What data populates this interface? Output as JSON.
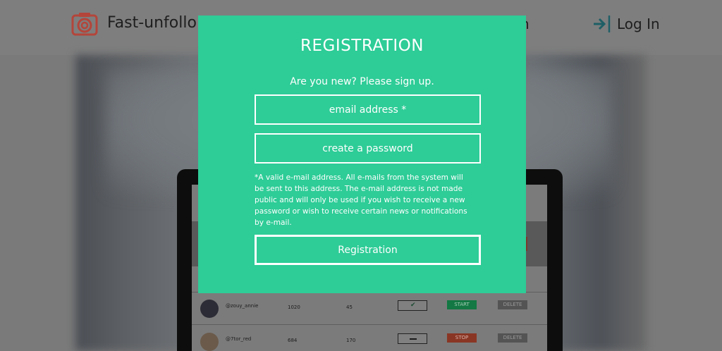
{
  "header": {
    "brand": "Fast-unfollo",
    "nav_fragment": "n",
    "login_label": "Log In",
    "logo_icon": "camera-icon",
    "login_icon": "sign-in-arrow-icon"
  },
  "modal": {
    "title": "REGISTRATION",
    "subtitle": "Are you new? Please sign up.",
    "email_placeholder": "email address *",
    "password_placeholder": "create a password",
    "note": "*A valid e-mail address. All e-mails from the system will be sent to this address. The e-mail address is not made public and will only be used if you wish to receive a new password or wish to receive certain news or notifications by e-mail.",
    "submit_label": "Registration"
  },
  "background_table": {
    "rows": [
      {
        "username": "@zouy_annie",
        "stat1": "1020",
        "stat2": "45",
        "status": "check",
        "action": "START",
        "delete": "DELETE"
      },
      {
        "username": "@7tor_red",
        "stat1": "684",
        "stat2": "170",
        "status": "dash",
        "action": "STOP",
        "delete": "DELETE"
      }
    ]
  },
  "colors": {
    "modal_bg": "#2ecc97",
    "logo_red": "#b4453a",
    "login_accent": "#1f5f66",
    "overlay_gray": "#7d7d7d"
  }
}
